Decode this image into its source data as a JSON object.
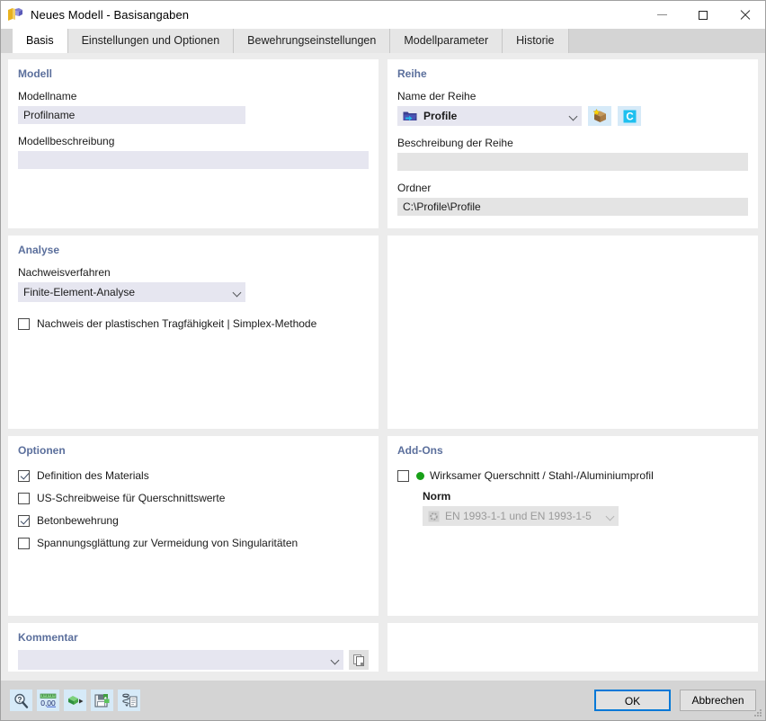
{
  "window": {
    "title": "Neues Modell - Basisangaben",
    "app_icon": "app-logo-icon",
    "minimize_label": "",
    "maximize_label": "",
    "close_label": ""
  },
  "tabs": [
    {
      "label": "Basis",
      "active": true
    },
    {
      "label": "Einstellungen und Optionen",
      "active": false
    },
    {
      "label": "Bewehrungseinstellungen",
      "active": false
    },
    {
      "label": "Modellparameter",
      "active": false
    },
    {
      "label": "Historie",
      "active": false
    }
  ],
  "model_panel": {
    "title": "Modell",
    "name_label": "Modellname",
    "name_value": "Profilname",
    "description_label": "Modellbeschreibung",
    "description_value": ""
  },
  "series_panel": {
    "title": "Reihe",
    "name_label": "Name der Reihe",
    "name_value": "Profile",
    "folder_icon": "folder-arrow-icon",
    "btn_package_icon": "package-star-icon",
    "btn_c_icon": "letter-c-icon",
    "description_label": "Beschreibung der Reihe",
    "description_value": "",
    "folder_label": "Ordner",
    "folder_value": "C:\\Profile\\Profile"
  },
  "analysis_panel": {
    "title": "Analyse",
    "method_label": "Nachweisverfahren",
    "method_value": "Finite-Element-Analyse",
    "plastic_checkbox": {
      "label": "Nachweis der plastischen Tragfähigkeit | Simplex-Methode",
      "checked": false
    }
  },
  "options_panel": {
    "title": "Optionen",
    "items": [
      {
        "label": "Definition des Materials",
        "checked": true
      },
      {
        "label": "US-Schreibweise für Querschnittswerte",
        "checked": false
      },
      {
        "label": "Betonbewehrung",
        "checked": true
      },
      {
        "label": "Spannungsglättung zur Vermeidung von Singularitäten",
        "checked": false
      }
    ]
  },
  "addons_panel": {
    "title": "Add-Ons",
    "item": {
      "label": "Wirksamer Querschnitt / Stahl-/Aluminiumprofil",
      "checked": false,
      "status_color": "#18a018"
    },
    "norm_label": "Norm",
    "norm_value": "EN 1993-1-1 und EN 1993-1-5",
    "norm_icon": "gear-disabled-icon",
    "norm_disabled": true
  },
  "comment_panel": {
    "title": "Kommentar",
    "value": "",
    "copy_icon": "copy-pages-icon"
  },
  "footer": {
    "tools": [
      {
        "name": "search-help-icon",
        "label": ""
      },
      {
        "name": "units-000-icon",
        "label": "0,00"
      },
      {
        "name": "import-arrow-icon",
        "label": ""
      },
      {
        "name": "save-floppy-icon",
        "label": ""
      },
      {
        "name": "spring-document-icon",
        "label": ""
      }
    ],
    "ok_label": "OK",
    "cancel_label": "Abbrechen"
  }
}
